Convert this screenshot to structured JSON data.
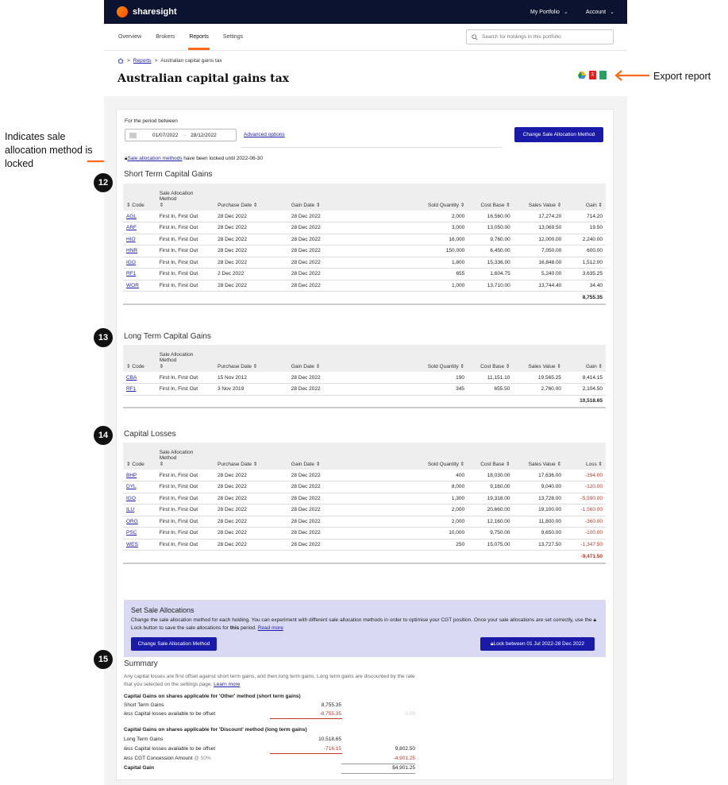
{
  "app": {
    "brand": "sharesight",
    "nav_portfolio": "My Portfolio",
    "nav_account": "Account"
  },
  "tabs": [
    "Overview",
    "Brokers",
    "Reports",
    "Settings"
  ],
  "search": {
    "placeholder": "Search for holdings in this portfolio"
  },
  "breadcrumb": {
    "reports": "Reports",
    "current": "Australian capital gains tax",
    "sep": ">"
  },
  "page_title": "Australian capital gains tax",
  "annotations": {
    "export": "Export report",
    "locked": "Indicates sale allocation method is locked",
    "n12": "12",
    "n13": "13",
    "n14": "14",
    "n15": "15"
  },
  "filter": {
    "period_label": "For the period between",
    "start": "01/07/2022",
    "dash": "–",
    "end": "28/12/2022",
    "advanced": "Advanced options",
    "change_btn": "Change Sale Allocation Method",
    "lock_link": "Sale allocation methods",
    "lock_text": " have been locked until 2022-06-30"
  },
  "headers": {
    "code": "⇕ Code",
    "alloc1": "Sale Allocation",
    "alloc2": "Method",
    "alloc3": "⇕",
    "purchase": "Purchase Date ⇕",
    "gaindate": "Gain Date ⇕",
    "qty": "Sold Quantity ⇕",
    "cost": "Cost Base ⇕",
    "sales": "Sales Value ⇕",
    "gain": "Gain ⇕",
    "loss": "Loss ⇕"
  },
  "short_term": {
    "title": "Short Term Capital Gains",
    "rows": [
      [
        "AGL",
        "First In, First Out",
        "28 Dec 2022",
        "28 Dec 2022",
        "2,000",
        "16,560.00",
        "17,274.20",
        "714.20"
      ],
      [
        "ARF",
        "First In, First Out",
        "28 Dec 2022",
        "28 Dec 2022",
        "3,000",
        "13,050.00",
        "13,069.50",
        "19.50"
      ],
      [
        "HIO",
        "First In, First Out",
        "28 Dec 2022",
        "28 Dec 2022",
        "16,000",
        "9,760.00",
        "12,000.00",
        "2,240.00"
      ],
      [
        "HNR",
        "First In, First Out",
        "28 Dec 2022",
        "28 Dec 2022",
        "150,000",
        "6,450.00",
        "7,050.00",
        "600.00"
      ],
      [
        "IGO",
        "First In, First Out",
        "28 Dec 2022",
        "28 Dec 2022",
        "1,800",
        "15,336.00",
        "16,848.00",
        "1,512.00"
      ],
      [
        "RF1",
        "First In, First Out",
        "2 Dec 2022",
        "28 Dec 2022",
        "655",
        "1,604.75",
        "5,240.00",
        "3,635.25"
      ],
      [
        "WOR",
        "First In, First Out",
        "28 Dec 2022",
        "28 Dec 2022",
        "1,000",
        "13,710.00",
        "13,744.40",
        "34.40"
      ]
    ],
    "total": "8,755.35"
  },
  "long_term": {
    "title": "Long Term Capital Gains",
    "rows": [
      [
        "CBA",
        "First In, First Out",
        "15 Nov 2012",
        "28 Dec 2022",
        "190",
        "11,151.10",
        "19,565.25",
        "8,414.15"
      ],
      [
        "RF1",
        "First In, First Out",
        "3 Nov 2019",
        "28 Dec 2022",
        "345",
        "655.50",
        "2,760.00",
        "2,104.50"
      ]
    ],
    "total": "10,518.65"
  },
  "losses": {
    "title": "Capital Losses",
    "rows": [
      [
        "BHP",
        "First In, First Out",
        "28 Dec 2022",
        "28 Dec 2022",
        "400",
        "18,030.00",
        "17,636.00",
        "-394.00"
      ],
      [
        "DYL",
        "First In, First Out",
        "28 Dec 2022",
        "28 Dec 2022",
        "8,000",
        "9,160.00",
        "9,040.00",
        "-120.00"
      ],
      [
        "IGO",
        "First In, First Out",
        "28 Dec 2022",
        "28 Dec 2022",
        "1,300",
        "19,318.00",
        "13,728.00",
        "-5,590.00"
      ],
      [
        "ILU",
        "First In, First Out",
        "28 Dec 2022",
        "28 Dec 2022",
        "2,000",
        "20,660.00",
        "19,100.00",
        "-1,560.00"
      ],
      [
        "ORG",
        "First In, First Out",
        "28 Dec 2022",
        "28 Dec 2022",
        "2,000",
        "12,160.00",
        "11,800.00",
        "-360.00"
      ],
      [
        "PSC",
        "First In, First Out",
        "28 Dec 2022",
        "28 Dec 2022",
        "10,000",
        "9,750.00",
        "9,650.00",
        "-100.00"
      ],
      [
        "WES",
        "First In, First Out",
        "28 Dec 2022",
        "28 Dec 2022",
        "250",
        "15,075.00",
        "13,727.50",
        "-1,347.50"
      ]
    ],
    "total": "-9,471.50"
  },
  "set_alloc": {
    "title": "Set Sale Allocations",
    "text1": "Change the sale allocation method for each holding. You can experiment with different sale allocation methods in order to optimise your CGT position. Once your sale allocations are set correctly, use the",
    "lock_word": "Lock",
    "text2": "button to save the sale allocations for",
    "this_period": "this",
    "text3": "period.",
    "read_more": "Read more",
    "change_btn": "Change Sale Allocation Method",
    "lock_btn": "Lock between 01 Jul 2022-28 Dec 2022"
  },
  "summary": {
    "title": "Summary",
    "desc1": "Any capital losses are first offset against short term gains, and then long term gains. Long term gains are discounted by the rate",
    "desc2": "that you selected on the settings page.",
    "learn_more": "Learn more",
    "other_heading": "Capital Gains on shares applicable for 'Other' method (short term gains)",
    "stg_label": "Short Term Gains",
    "stg_val": "8,755.35",
    "less_label_em": "less",
    "less_label": " Capital losses available to be offset",
    "stg_offset": "-8,755.35",
    "stg_result": "0.00",
    "discount_heading": "Capital Gains on shares applicable for 'Discount' method (long term gains)",
    "ltg_label": "Long Term Gains",
    "ltg_val": "10,518.65",
    "ltg_offset": "-716.15",
    "ltg_after": "9,802.50",
    "concession_label": " CGT Concession Amount",
    "concession_rate": "@ 50%",
    "concession_val": "-4,901.25",
    "cg_label": "Capital Gain",
    "cg_val": "$4,901.25"
  }
}
